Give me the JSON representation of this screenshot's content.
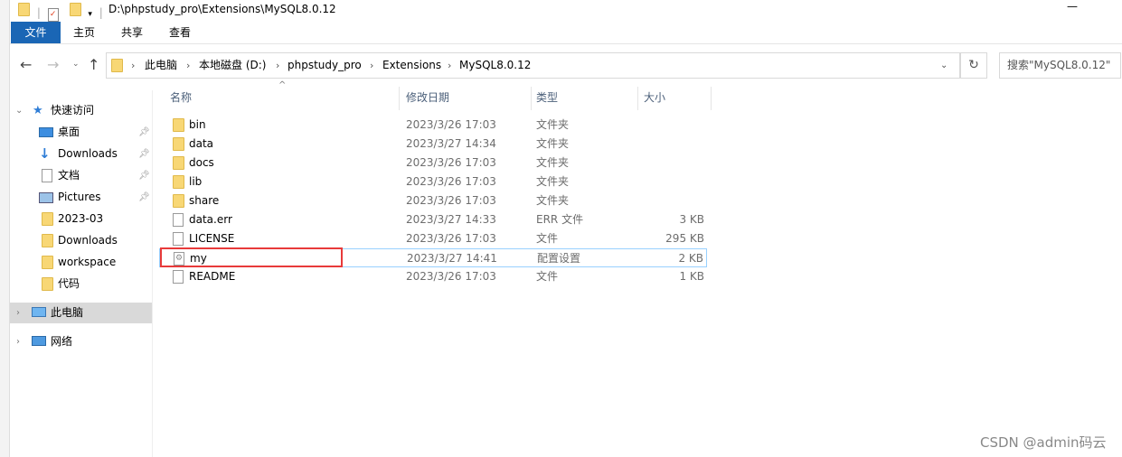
{
  "window": {
    "title": "D:\\phpstudy_pro\\Extensions\\MySQL8.0.12",
    "close": "—"
  },
  "ribbon": {
    "tabs": [
      "文件",
      "主页",
      "共享",
      "查看"
    ],
    "accent": "#1a66b5"
  },
  "address": {
    "crumbs": [
      "此电脑",
      "本地磁盘 (D:)",
      "phpstudy_pro",
      "Extensions",
      "MySQL8.0.12"
    ],
    "search_placeholder": "搜索\"MySQL8.0.12\""
  },
  "nav": {
    "quick_access": "快速访问",
    "items": [
      {
        "label": "桌面",
        "icon": "desktop-icon",
        "pinned": true
      },
      {
        "label": "Downloads",
        "icon": "download-icon",
        "pinned": true
      },
      {
        "label": "文档",
        "icon": "document-icon",
        "pinned": true
      },
      {
        "label": "Pictures",
        "icon": "pictures-icon",
        "pinned": true
      },
      {
        "label": "2023-03",
        "icon": "folder-icon",
        "pinned": false
      },
      {
        "label": "Downloads",
        "icon": "folder-icon",
        "pinned": false
      },
      {
        "label": "workspace",
        "icon": "folder-icon",
        "pinned": false
      },
      {
        "label": "代码",
        "icon": "folder-icon",
        "pinned": false
      }
    ],
    "this_pc": "此电脑",
    "network": "网络"
  },
  "columns": [
    "名称",
    "修改日期",
    "类型",
    "大小"
  ],
  "files": [
    {
      "name": "bin",
      "date": "2023/3/26 17:03",
      "type": "文件夹",
      "size": "",
      "kind": "folder"
    },
    {
      "name": "data",
      "date": "2023/3/27 14:34",
      "type": "文件夹",
      "size": "",
      "kind": "folder"
    },
    {
      "name": "docs",
      "date": "2023/3/26 17:03",
      "type": "文件夹",
      "size": "",
      "kind": "folder"
    },
    {
      "name": "lib",
      "date": "2023/3/26 17:03",
      "type": "文件夹",
      "size": "",
      "kind": "folder"
    },
    {
      "name": "share",
      "date": "2023/3/26 17:03",
      "type": "文件夹",
      "size": "",
      "kind": "folder"
    },
    {
      "name": "data.err",
      "date": "2023/3/27 14:33",
      "type": "ERR 文件",
      "size": "3 KB",
      "kind": "file"
    },
    {
      "name": "LICENSE",
      "date": "2023/3/26 17:03",
      "type": "文件",
      "size": "295 KB",
      "kind": "file"
    },
    {
      "name": "my",
      "date": "2023/3/27 14:41",
      "type": "配置设置",
      "size": "2 KB",
      "kind": "config",
      "selected": true,
      "highlight": "#e83a3a"
    },
    {
      "name": "README",
      "date": "2023/3/26 17:03",
      "type": "文件",
      "size": "1 KB",
      "kind": "file"
    }
  ],
  "watermark": "CSDN @admin码云"
}
